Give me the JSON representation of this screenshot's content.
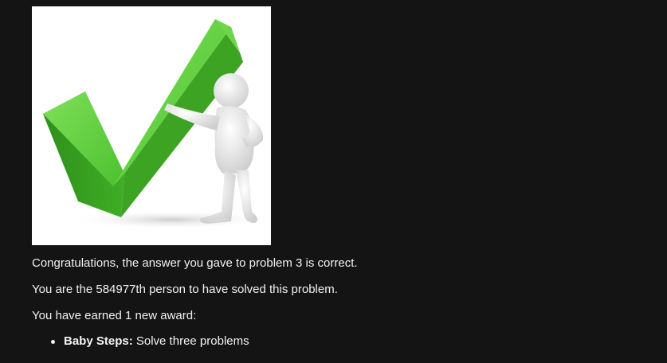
{
  "result": {
    "image_alt": "green check mark with figure",
    "congrats_text": "Congratulations, the answer you gave to problem 3 is correct.",
    "solver_text": "You are the 584977th person to have solved this problem.",
    "awards_heading": "You have earned 1 new award:"
  },
  "awards": [
    {
      "name": "Baby Steps:",
      "description": " Solve three problems"
    }
  ],
  "colors": {
    "background": "#141414",
    "text": "#f2f2f2",
    "check_green": "#4cc12e"
  },
  "icons": {
    "hero": "check-mark-figure-image",
    "list_marker": "bullet"
  }
}
